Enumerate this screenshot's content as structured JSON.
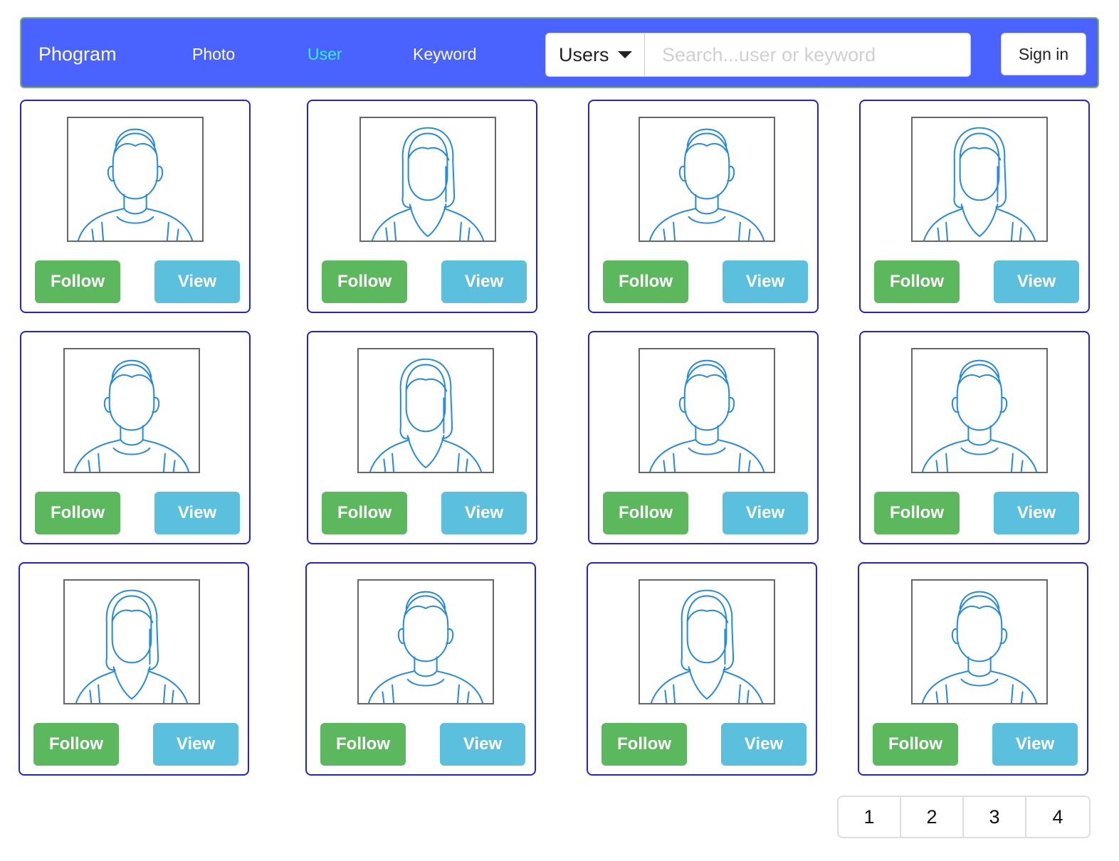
{
  "navbar": {
    "brand": "Phogram",
    "links": [
      {
        "label": "Photo",
        "active": false
      },
      {
        "label": "User",
        "active": true
      },
      {
        "label": "Keyword",
        "active": false
      }
    ],
    "search": {
      "type_selected": "Users",
      "value": "",
      "placeholder": "Search...user or keyword"
    },
    "sign_in_label": "Sign in"
  },
  "colors": {
    "navbar_background": "#4a63ff",
    "active_link": "#2ff3ff",
    "card_border": "#2222dd",
    "follow_button": "#5cb85c",
    "view_button": "#5bc0de",
    "avatar_line": "#1e88e5"
  },
  "users": [
    {
      "avatar_icon": "male-avatar-icon",
      "follow_label": "Follow",
      "view_label": "View"
    },
    {
      "avatar_icon": "female-avatar-icon",
      "follow_label": "Follow",
      "view_label": "View"
    },
    {
      "avatar_icon": "male-avatar-icon",
      "follow_label": "Follow",
      "view_label": "View"
    },
    {
      "avatar_icon": "female-avatar-icon",
      "follow_label": "Follow",
      "view_label": "View"
    },
    {
      "avatar_icon": "male-avatar-icon",
      "follow_label": "Follow",
      "view_label": "View"
    },
    {
      "avatar_icon": "female-avatar-icon",
      "follow_label": "Follow",
      "view_label": "View"
    },
    {
      "avatar_icon": "male-avatar-icon",
      "follow_label": "Follow",
      "view_label": "View"
    },
    {
      "avatar_icon": "male-avatar-icon",
      "follow_label": "Follow",
      "view_label": "View"
    },
    {
      "avatar_icon": "female-avatar-icon",
      "follow_label": "Follow",
      "view_label": "View"
    },
    {
      "avatar_icon": "male-avatar-icon",
      "follow_label": "Follow",
      "view_label": "View"
    },
    {
      "avatar_icon": "female-avatar-icon",
      "follow_label": "Follow",
      "view_label": "View"
    },
    {
      "avatar_icon": "male-avatar-icon",
      "follow_label": "Follow",
      "view_label": "View"
    }
  ],
  "pagination": {
    "pages": [
      "1",
      "2",
      "3",
      "4"
    ]
  }
}
